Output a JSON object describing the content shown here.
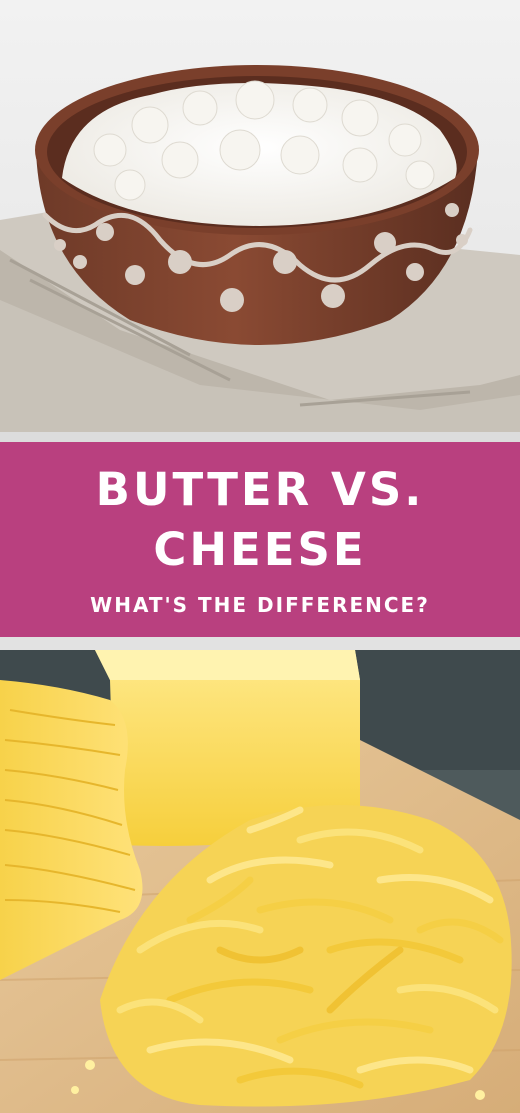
{
  "banner": {
    "title_line_1": "BUTTER VS.",
    "title_line_2": "CHEESE",
    "subtitle": "WHAT'S THE DIFFERENCE?"
  },
  "colors": {
    "banner_background": "#b9407f",
    "banner_text": "#ffffff",
    "divider": "#dcdcdc"
  },
  "images": {
    "top": "bowl-of-cottage-cheese-photo",
    "bottom": "block-and-shredded-cheddar-photo"
  }
}
